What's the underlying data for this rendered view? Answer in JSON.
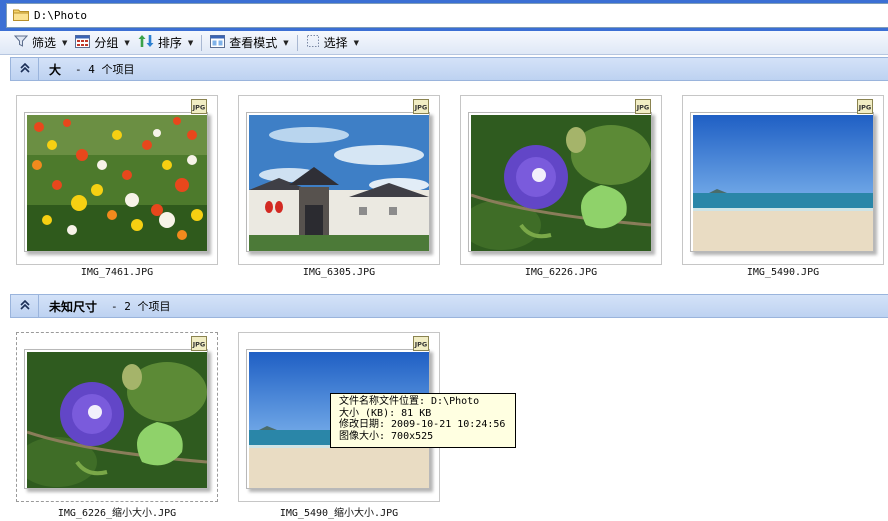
{
  "address": {
    "path": "D:\\Photo"
  },
  "toolbar": {
    "filter": "筛选",
    "group": "分组",
    "sort": "排序",
    "view": "查看模式",
    "select": "选择"
  },
  "groups": [
    {
      "name": "大",
      "count": "- 4 个项目",
      "items": [
        {
          "file": "IMG_7461.JPG",
          "badge": "JPG"
        },
        {
          "file": "IMG_6305.JPG",
          "badge": "JPG"
        },
        {
          "file": "IMG_6226.JPG",
          "badge": "JPG"
        },
        {
          "file": "IMG_5490.JPG",
          "badge": "JPG"
        }
      ]
    },
    {
      "name": "未知尺寸",
      "count": "- 2 个项目",
      "items": [
        {
          "file": "IMG_6226_缩小大小.JPG",
          "badge": "JPG"
        },
        {
          "file": "IMG_5490_缩小大小.JPG",
          "badge": "JPG"
        }
      ]
    }
  ],
  "tooltip": {
    "line1": "文件名称文件位置: D:\\Photo",
    "line2": "大小 (KB): 81 KB",
    "line3": "修改日期: 2009-10-21 10:24:56",
    "line4": "图像大小: 700x525"
  },
  "colors": {
    "titlebar": "#3b6fd4",
    "header": "#c6d8f4",
    "tooltip": "#ffffe1"
  }
}
